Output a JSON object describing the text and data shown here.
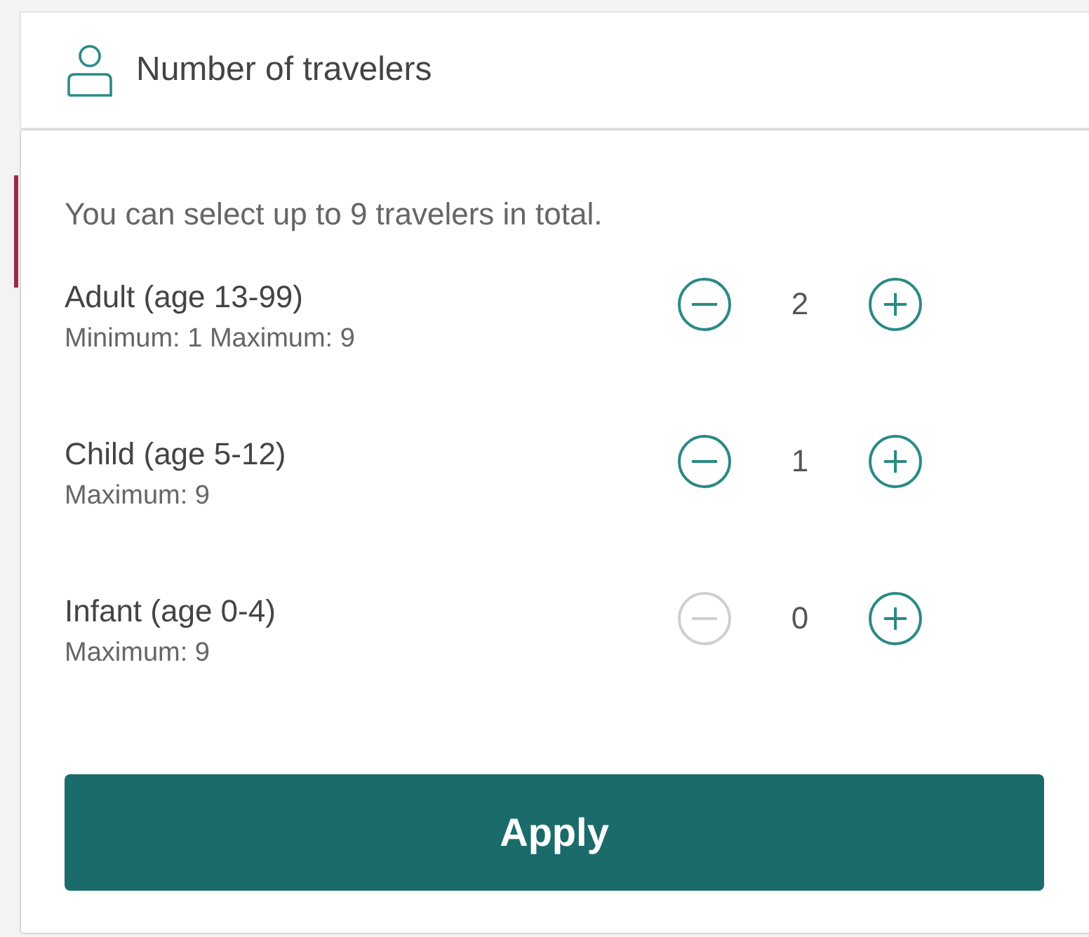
{
  "field": {
    "placeholder": "Number of travelers"
  },
  "note": "You can select up to 9 travelers in total.",
  "rows": [
    {
      "label": "Adult (age 13-99)",
      "limits": "Minimum: 1 Maximum: 9",
      "count": "2",
      "decrease_disabled": false
    },
    {
      "label": "Child (age 5-12)",
      "limits": "Maximum: 9",
      "count": "1",
      "decrease_disabled": false
    },
    {
      "label": "Infant (age 0-4)",
      "limits": "Maximum: 9",
      "count": "0",
      "decrease_disabled": true
    }
  ],
  "apply_button": "Apply"
}
